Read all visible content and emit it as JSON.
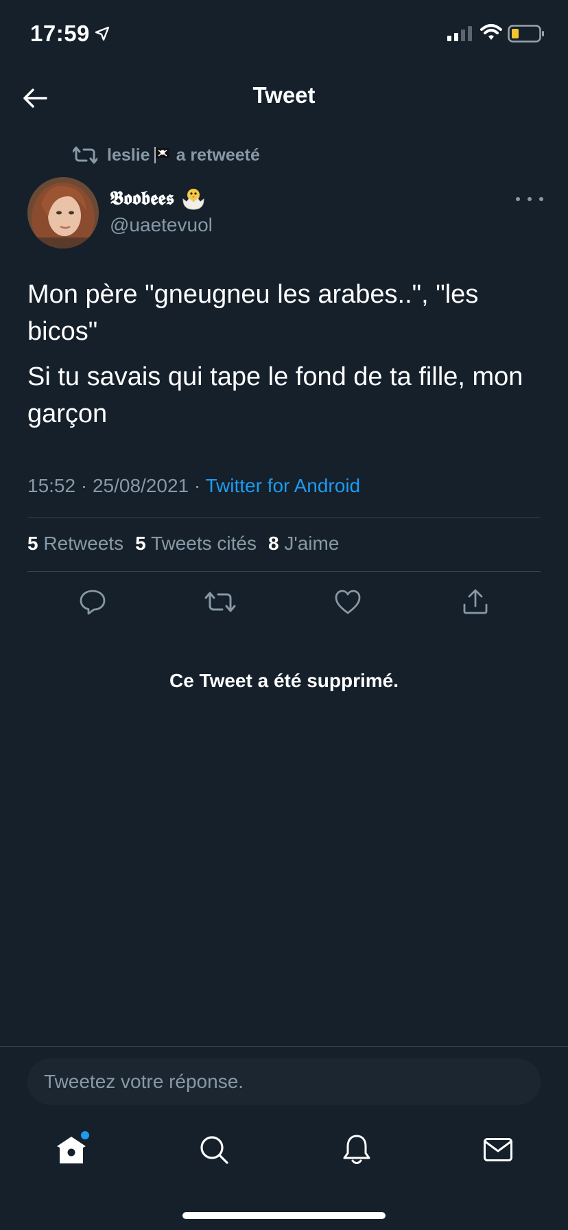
{
  "status_bar": {
    "time": "17:59"
  },
  "header": {
    "title": "Tweet"
  },
  "retweet": {
    "user": "leslie",
    "label": "a retweeté"
  },
  "author": {
    "name": "𝕭𝖔𝖔𝖇𝖊𝖊𝖘",
    "handle": "@uaetevuol"
  },
  "tweet": {
    "paragraphs": [
      "Mon père \"gneugneu les arabes..\", \"les bicos\"",
      "Si tu savais qui tape le fond de ta fille, mon garçon"
    ],
    "time": "15:52 · 25/08/2021 · ",
    "source": "Twitter for Android"
  },
  "stats": {
    "retweets_count": "5",
    "retweets_label": "Retweets",
    "quotes_count": "5",
    "quotes_label": "Tweets cités",
    "likes_count": "8",
    "likes_label": "J'aime"
  },
  "deleted_notice": "Ce Tweet a été supprimé.",
  "reply": {
    "placeholder": "Tweetez votre réponse."
  },
  "icons": {
    "reply": "reply-icon",
    "retweet": "retweet-icon",
    "like": "heart-icon",
    "share": "share-icon",
    "home": "home-icon",
    "search": "search-icon",
    "notifications": "bell-icon",
    "messages": "mail-icon"
  },
  "colors": {
    "background": "#15202b",
    "accent": "#1d9bf0",
    "muted": "#8899a6"
  }
}
